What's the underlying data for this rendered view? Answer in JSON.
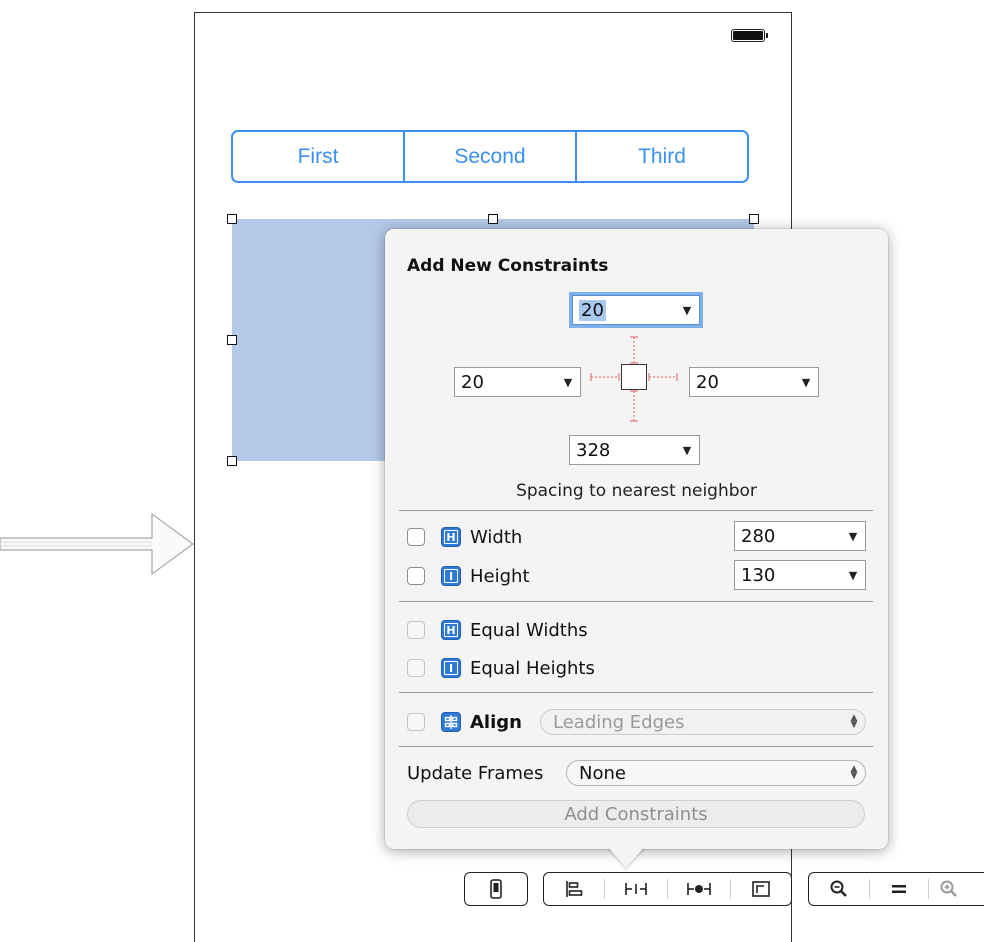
{
  "canvas": {
    "segmented_control": [
      "First",
      "Second",
      "Third"
    ]
  },
  "popover": {
    "title": "Add New Constraints",
    "spacing": {
      "top": "20",
      "left": "20",
      "right": "20",
      "bottom": "328"
    },
    "spacing_label": "Spacing to nearest neighbor",
    "size_rows": [
      {
        "label": "Width",
        "value": "280",
        "icon": "width-icon"
      },
      {
        "label": "Height",
        "value": "130",
        "icon": "height-icon"
      }
    ],
    "equal_rows": [
      {
        "label": "Equal Widths",
        "icon": "equal-widths-icon"
      },
      {
        "label": "Equal Heights",
        "icon": "equal-heights-icon"
      }
    ],
    "align": {
      "label": "Align",
      "value": "Leading Edges",
      "icon": "align-icon"
    },
    "update_frames": {
      "label": "Update Frames",
      "value": "None"
    },
    "add_button": "Add Constraints"
  },
  "toolbar": {
    "groups": [
      [
        "device-icon"
      ],
      [
        "align-icon",
        "pin-icon",
        "resolve-icon",
        "resizing-icon"
      ],
      [
        "zoom-out-icon",
        "zoom-actual-icon",
        "zoom-in-icon"
      ]
    ]
  },
  "colors": {
    "accent": "#3a8ff0",
    "selection": "#b4c8e8",
    "focus_ring": "#7fb0ea",
    "icon_blue": "#2e7ad6",
    "guide_red": "#e06060"
  }
}
